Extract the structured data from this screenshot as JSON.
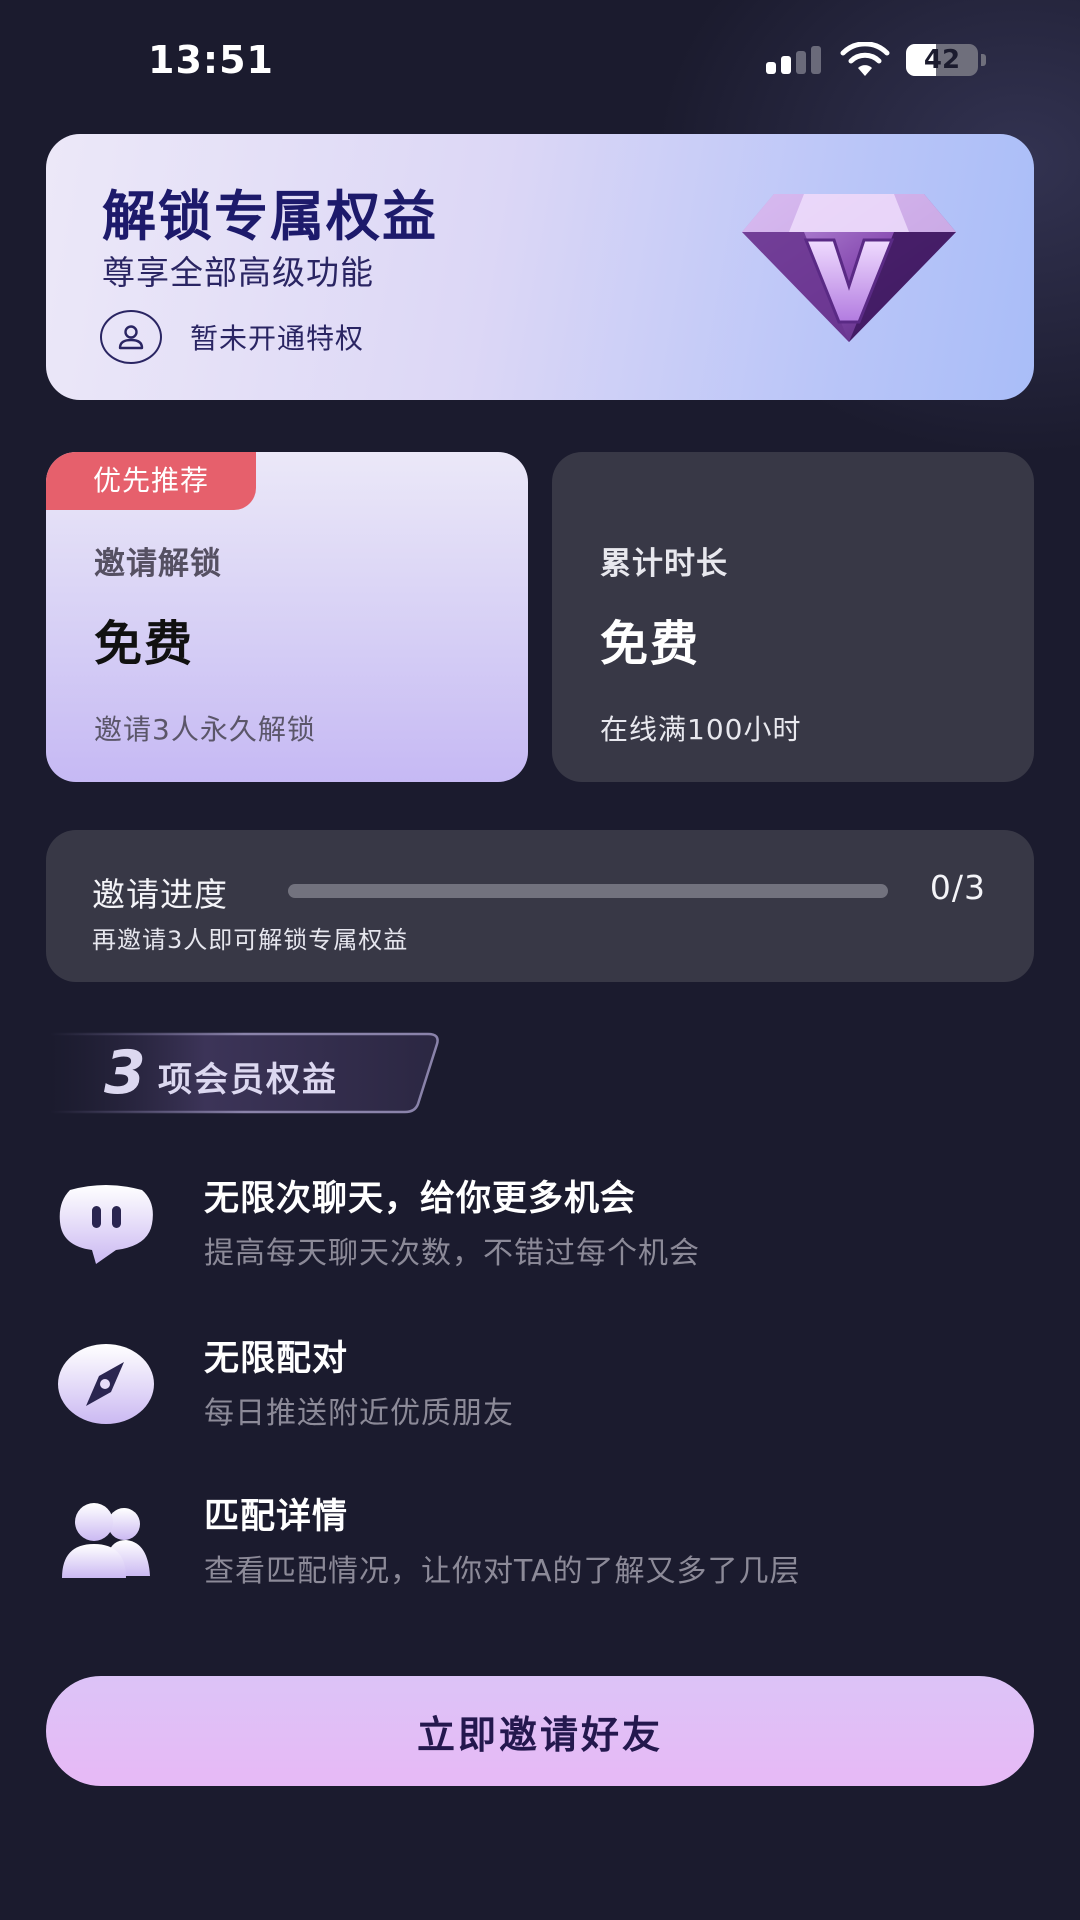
{
  "status_bar": {
    "time": "13:51",
    "battery_level": "42",
    "battery_percent": 42
  },
  "hero": {
    "title": "解锁专属权益",
    "subtitle": "尊享全部高级功能",
    "status_text": "暂未开通特权"
  },
  "options": {
    "invite": {
      "badge": "优先推荐",
      "label": "邀请解锁",
      "price": "免费",
      "note": "邀请3人永久解锁"
    },
    "time": {
      "label": "累计时长",
      "price": "免费",
      "note": "在线满100小时"
    }
  },
  "progress": {
    "title": "邀请进度",
    "subtitle": "再邀请3人即可解锁专属权益",
    "count_text": "0/3",
    "current": 0,
    "total": 3
  },
  "benefits": {
    "count": "3",
    "label": "项会员权益",
    "items": [
      {
        "title": "无限次聊天，给你更多机会",
        "desc": "提高每天聊天次数，不错过每个机会",
        "icon": "chat-bubble-icon"
      },
      {
        "title": "无限配对",
        "desc": "每日推送附近优质朋友",
        "icon": "compass-icon"
      },
      {
        "title": "匹配详情",
        "desc": "查看匹配情况，让你对TA的了解又多了几层",
        "icon": "users-icon"
      }
    ]
  },
  "cta": {
    "label": "立即邀请好友"
  },
  "colors": {
    "background": "#1b1b2e",
    "hero_title": "#1d1a6b",
    "badge": "#e6606c",
    "card_dark": "#383846",
    "cta_start": "#dcc3f7",
    "cta_end": "#e7b9f6"
  }
}
